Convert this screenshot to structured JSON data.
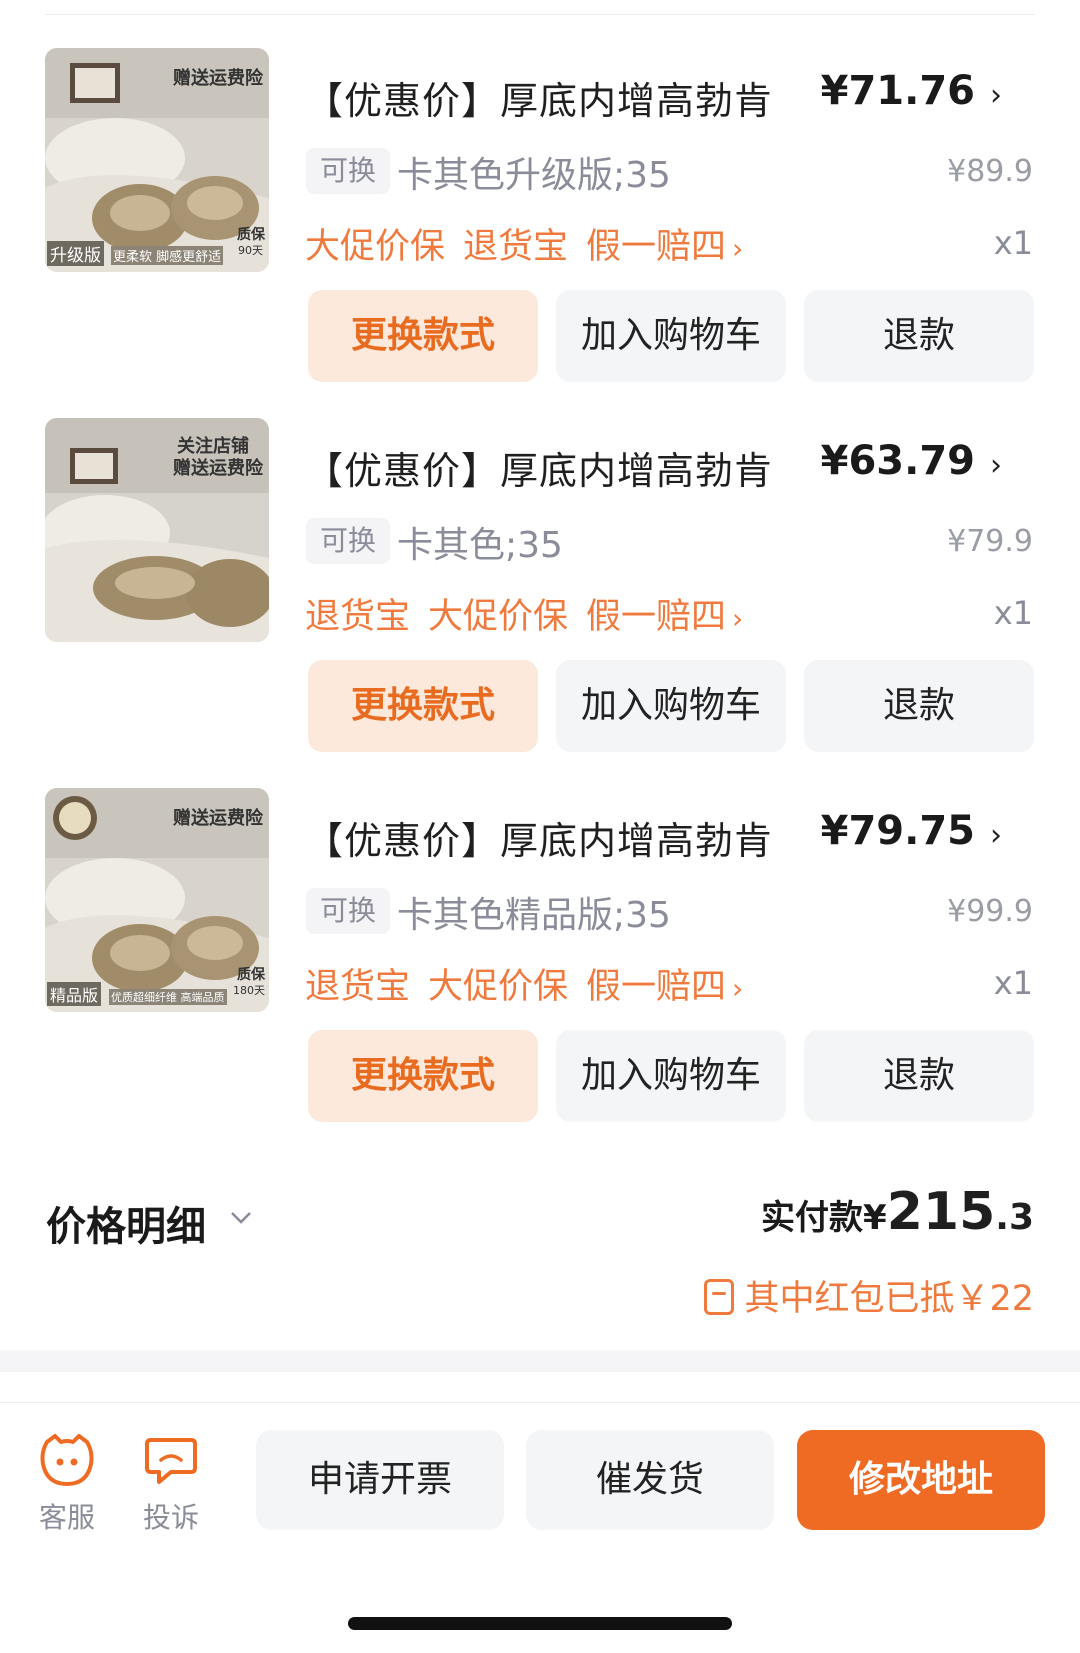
{
  "items": [
    {
      "title": "【优惠价】厚底内增高勃肯",
      "price": "¥71.76",
      "swap_tag": "可换",
      "sku": "卡其色升级版;35",
      "original_price": "¥89.9",
      "services": [
        "大促价保",
        "退货宝",
        "假一赔四"
      ],
      "qty": "x1",
      "thumb_text": [
        "赠送运费险",
        "升级版",
        "更柔软 脚感更舒适",
        "质保",
        "90天"
      ],
      "buttons": {
        "swap": "更换款式",
        "cart": "加入购物车",
        "refund": "退款"
      }
    },
    {
      "title": "【优惠价】厚底内增高勃肯",
      "price": "¥63.79",
      "swap_tag": "可换",
      "sku": "卡其色;35",
      "original_price": "¥79.9",
      "services": [
        "退货宝",
        "大促价保",
        "假一赔四"
      ],
      "qty": "x1",
      "thumb_text": [
        "关注店铺",
        "赠送运费险"
      ],
      "buttons": {
        "swap": "更换款式",
        "cart": "加入购物车",
        "refund": "退款"
      }
    },
    {
      "title": "【优惠价】厚底内增高勃肯",
      "price": "¥79.75",
      "swap_tag": "可换",
      "sku": "卡其色精品版;35",
      "original_price": "¥99.9",
      "services": [
        "退货宝",
        "大促价保",
        "假一赔四"
      ],
      "qty": "x1",
      "thumb_text": [
        "赠送运费险",
        "精品版",
        "优质超细纤维 高端品质",
        "质保",
        "180天"
      ],
      "buttons": {
        "swap": "更换款式",
        "cart": "加入购物车",
        "refund": "退款"
      }
    }
  ],
  "summary": {
    "price_detail": "价格明细",
    "paid_label": "实付款¥",
    "paid_int": "215",
    "paid_dec": ".3",
    "redpack": "其中红包已抵￥22"
  },
  "bottom": {
    "service_label": "客服",
    "complain_label": "投诉",
    "invoice": "申请开票",
    "urge": "催发货",
    "address": "修改地址"
  },
  "colors": {
    "accent": "#ef6a22",
    "service_text": "#f07a3e",
    "muted": "#8a8d99"
  }
}
